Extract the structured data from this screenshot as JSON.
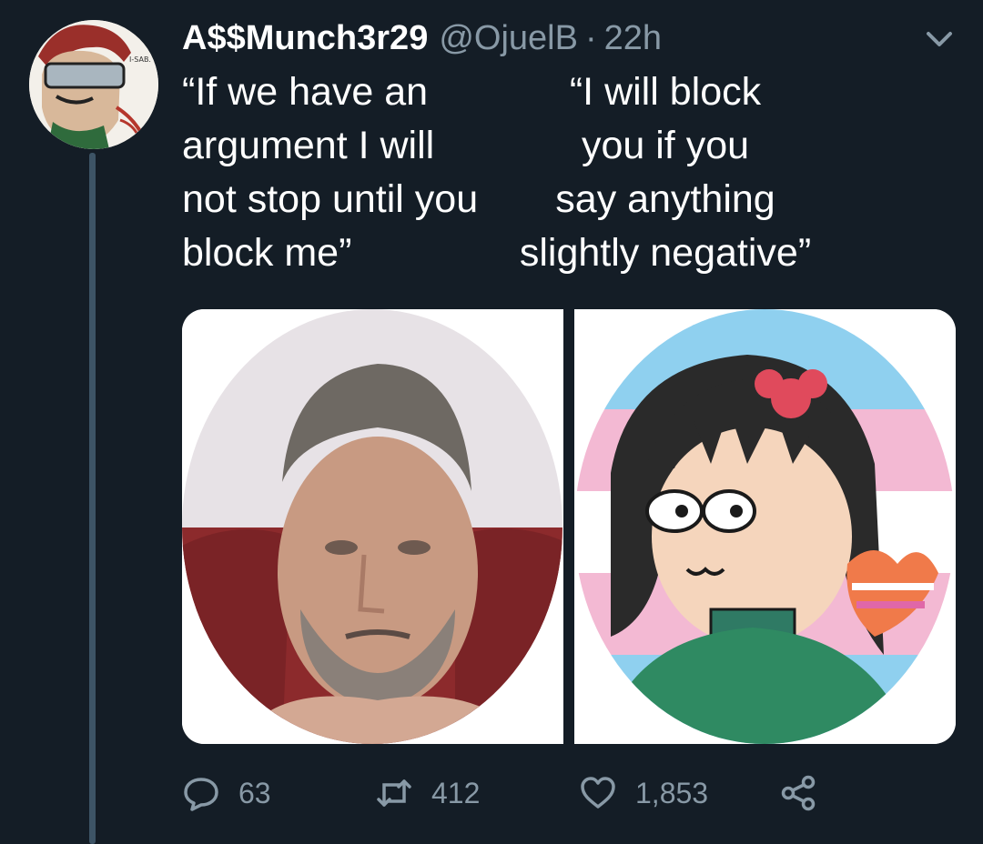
{
  "tweet": {
    "display_name": "A$$Munch3r29",
    "handle": "@OjuelB",
    "separator": "·",
    "time": "22h",
    "quote_left": [
      "“If we have an",
      "argument I will",
      "not stop until you",
      "block me”"
    ],
    "quote_right": [
      "“I will block",
      "you if you",
      "say anything",
      "slightly negative”"
    ],
    "avatar_caption": "I-SAB.",
    "icons": {
      "avatar": "avatar-anime-character",
      "menu": "chevron-down-icon",
      "reply": "reply-icon",
      "retweet": "retweet-icon",
      "like": "heart-icon",
      "share": "share-icon"
    }
  },
  "media": [
    {
      "name": "photo-middle-aged-man",
      "description_visible": false
    },
    {
      "name": "cartoon-girl-with-bow",
      "description_visible": false
    }
  ],
  "actions": {
    "reply_count": "63",
    "retweet_count": "412",
    "like_count": "1,853"
  },
  "colors": {
    "background": "#141d26",
    "text_primary": "#ffffff",
    "text_secondary": "#8899a6",
    "thread_line": "#3d5466"
  }
}
